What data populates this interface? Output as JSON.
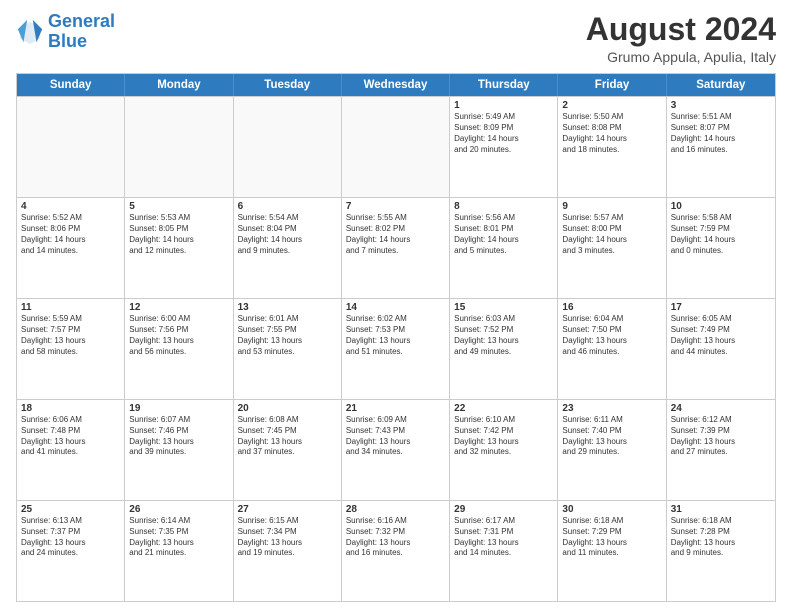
{
  "logo": {
    "text1": "General",
    "text2": "Blue"
  },
  "header": {
    "month_year": "August 2024",
    "location": "Grumo Appula, Apulia, Italy"
  },
  "day_headers": [
    "Sunday",
    "Monday",
    "Tuesday",
    "Wednesday",
    "Thursday",
    "Friday",
    "Saturday"
  ],
  "weeks": [
    {
      "days": [
        {
          "num": "",
          "info": "",
          "empty": true
        },
        {
          "num": "",
          "info": "",
          "empty": true
        },
        {
          "num": "",
          "info": "",
          "empty": true
        },
        {
          "num": "",
          "info": "",
          "empty": true
        },
        {
          "num": "1",
          "info": "Sunrise: 5:49 AM\nSunset: 8:09 PM\nDaylight: 14 hours\nand 20 minutes."
        },
        {
          "num": "2",
          "info": "Sunrise: 5:50 AM\nSunset: 8:08 PM\nDaylight: 14 hours\nand 18 minutes."
        },
        {
          "num": "3",
          "info": "Sunrise: 5:51 AM\nSunset: 8:07 PM\nDaylight: 14 hours\nand 16 minutes."
        }
      ]
    },
    {
      "days": [
        {
          "num": "4",
          "info": "Sunrise: 5:52 AM\nSunset: 8:06 PM\nDaylight: 14 hours\nand 14 minutes."
        },
        {
          "num": "5",
          "info": "Sunrise: 5:53 AM\nSunset: 8:05 PM\nDaylight: 14 hours\nand 12 minutes."
        },
        {
          "num": "6",
          "info": "Sunrise: 5:54 AM\nSunset: 8:04 PM\nDaylight: 14 hours\nand 9 minutes."
        },
        {
          "num": "7",
          "info": "Sunrise: 5:55 AM\nSunset: 8:02 PM\nDaylight: 14 hours\nand 7 minutes."
        },
        {
          "num": "8",
          "info": "Sunrise: 5:56 AM\nSunset: 8:01 PM\nDaylight: 14 hours\nand 5 minutes."
        },
        {
          "num": "9",
          "info": "Sunrise: 5:57 AM\nSunset: 8:00 PM\nDaylight: 14 hours\nand 3 minutes."
        },
        {
          "num": "10",
          "info": "Sunrise: 5:58 AM\nSunset: 7:59 PM\nDaylight: 14 hours\nand 0 minutes."
        }
      ]
    },
    {
      "days": [
        {
          "num": "11",
          "info": "Sunrise: 5:59 AM\nSunset: 7:57 PM\nDaylight: 13 hours\nand 58 minutes."
        },
        {
          "num": "12",
          "info": "Sunrise: 6:00 AM\nSunset: 7:56 PM\nDaylight: 13 hours\nand 56 minutes."
        },
        {
          "num": "13",
          "info": "Sunrise: 6:01 AM\nSunset: 7:55 PM\nDaylight: 13 hours\nand 53 minutes."
        },
        {
          "num": "14",
          "info": "Sunrise: 6:02 AM\nSunset: 7:53 PM\nDaylight: 13 hours\nand 51 minutes."
        },
        {
          "num": "15",
          "info": "Sunrise: 6:03 AM\nSunset: 7:52 PM\nDaylight: 13 hours\nand 49 minutes."
        },
        {
          "num": "16",
          "info": "Sunrise: 6:04 AM\nSunset: 7:50 PM\nDaylight: 13 hours\nand 46 minutes."
        },
        {
          "num": "17",
          "info": "Sunrise: 6:05 AM\nSunset: 7:49 PM\nDaylight: 13 hours\nand 44 minutes."
        }
      ]
    },
    {
      "days": [
        {
          "num": "18",
          "info": "Sunrise: 6:06 AM\nSunset: 7:48 PM\nDaylight: 13 hours\nand 41 minutes."
        },
        {
          "num": "19",
          "info": "Sunrise: 6:07 AM\nSunset: 7:46 PM\nDaylight: 13 hours\nand 39 minutes."
        },
        {
          "num": "20",
          "info": "Sunrise: 6:08 AM\nSunset: 7:45 PM\nDaylight: 13 hours\nand 37 minutes."
        },
        {
          "num": "21",
          "info": "Sunrise: 6:09 AM\nSunset: 7:43 PM\nDaylight: 13 hours\nand 34 minutes."
        },
        {
          "num": "22",
          "info": "Sunrise: 6:10 AM\nSunset: 7:42 PM\nDaylight: 13 hours\nand 32 minutes."
        },
        {
          "num": "23",
          "info": "Sunrise: 6:11 AM\nSunset: 7:40 PM\nDaylight: 13 hours\nand 29 minutes."
        },
        {
          "num": "24",
          "info": "Sunrise: 6:12 AM\nSunset: 7:39 PM\nDaylight: 13 hours\nand 27 minutes."
        }
      ]
    },
    {
      "days": [
        {
          "num": "25",
          "info": "Sunrise: 6:13 AM\nSunset: 7:37 PM\nDaylight: 13 hours\nand 24 minutes."
        },
        {
          "num": "26",
          "info": "Sunrise: 6:14 AM\nSunset: 7:35 PM\nDaylight: 13 hours\nand 21 minutes."
        },
        {
          "num": "27",
          "info": "Sunrise: 6:15 AM\nSunset: 7:34 PM\nDaylight: 13 hours\nand 19 minutes."
        },
        {
          "num": "28",
          "info": "Sunrise: 6:16 AM\nSunset: 7:32 PM\nDaylight: 13 hours\nand 16 minutes."
        },
        {
          "num": "29",
          "info": "Sunrise: 6:17 AM\nSunset: 7:31 PM\nDaylight: 13 hours\nand 14 minutes."
        },
        {
          "num": "30",
          "info": "Sunrise: 6:18 AM\nSunset: 7:29 PM\nDaylight: 13 hours\nand 11 minutes."
        },
        {
          "num": "31",
          "info": "Sunrise: 6:18 AM\nSunset: 7:28 PM\nDaylight: 13 hours\nand 9 minutes."
        }
      ]
    }
  ]
}
